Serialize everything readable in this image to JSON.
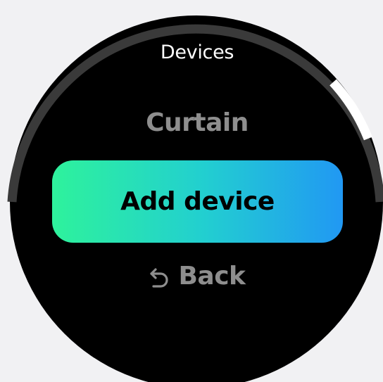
{
  "screen": {
    "title": "Devices"
  },
  "menu": {
    "items": [
      {
        "label": "Curtain"
      },
      {
        "label": "Add device"
      },
      {
        "label": "Back",
        "icon": "back-arrow-icon"
      }
    ]
  },
  "scroll": {
    "position": 0.55
  },
  "colors": {
    "background": "#000000",
    "gradient_start": "#2ef29c",
    "gradient_end": "#2198f3",
    "inactive_text": "#8e8e8e"
  }
}
